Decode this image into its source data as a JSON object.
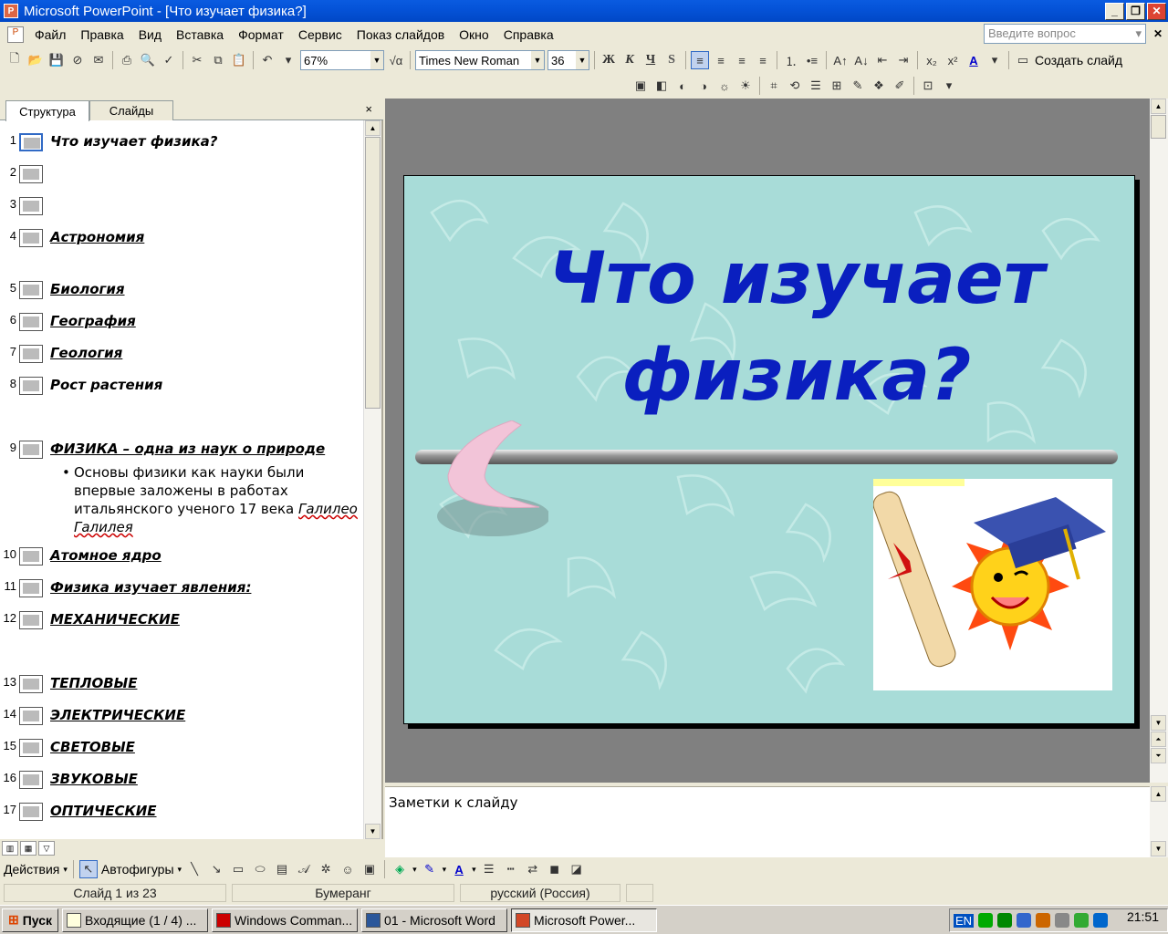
{
  "window": {
    "title": "Microsoft PowerPoint - [Что изучает физика?]",
    "minimize": "_",
    "restore": "❐",
    "close": "✕"
  },
  "menu": {
    "items": [
      "Файл",
      "Правка",
      "Вид",
      "Вставка",
      "Формат",
      "Сервис",
      "Показ слайдов",
      "Окно",
      "Справка"
    ],
    "ask_placeholder": "Введите вопрос"
  },
  "toolbar": {
    "zoom": "67%",
    "font_name": "Times New Roman",
    "font_size": "36",
    "bold": "Ж",
    "italic": "К",
    "underline": "Ч",
    "shadow": "S",
    "new_slide": "Создать слайд"
  },
  "left_pane": {
    "tab_outline": "Структура",
    "tab_slides": "Слайды",
    "close": "×",
    "slides": [
      {
        "num": "1",
        "title": "Что изучает физика?",
        "underline": false,
        "current": true
      },
      {
        "num": "2",
        "title": "",
        "underline": false
      },
      {
        "num": "3",
        "title": "",
        "underline": false
      },
      {
        "num": "4",
        "title": "Астрономия",
        "underline": true
      },
      {
        "num": "5",
        "title": "Биология",
        "underline": true
      },
      {
        "num": "6",
        "title": "География",
        "underline": true
      },
      {
        "num": "7",
        "title": "Геология",
        "underline": true
      },
      {
        "num": "8",
        "title": "Рост растения",
        "underline": false
      },
      {
        "num": "9",
        "title": "ФИЗИКА – одна из наук о природе",
        "underline": true
      },
      {
        "num": "10",
        "title": "Атомное ядро",
        "underline": true
      },
      {
        "num": "11",
        "title": "Физика изучает явления:",
        "underline": true
      },
      {
        "num": "12",
        "title": "МЕХАНИЧЕСКИЕ",
        "underline": true
      },
      {
        "num": "13",
        "title": "ТЕПЛОВЫЕ",
        "underline": true
      },
      {
        "num": "14",
        "title": "ЭЛЕКТРИЧЕСКИЕ",
        "underline": true
      },
      {
        "num": "15",
        "title": "СВЕТОВЫЕ",
        "underline": true
      },
      {
        "num": "16",
        "title": "ЗВУКОВЫЕ",
        "underline": true
      },
      {
        "num": "17",
        "title": "ОПТИЧЕСКИЕ",
        "underline": true
      }
    ],
    "slide9_bullet": {
      "text": "Основы физики как науки были впервые заложены в работах итальянского ученого 17 века",
      "name": "Галилео Галилея"
    }
  },
  "slide": {
    "title_line1": "Что изучает",
    "title_line2": "физика?",
    "title_color": "#0a1fbf",
    "background_color": "#a8dcd8"
  },
  "notes": {
    "label": "Заметки к слайду"
  },
  "drawing_toolbar": {
    "actions": "Действия",
    "autoshapes": "Автофигуры"
  },
  "status": {
    "slide_of": "Слайд 1 из 23",
    "design": "Бумеранг",
    "language": "русский (Россия)"
  },
  "taskbar": {
    "start": "Пуск",
    "tasks": [
      {
        "label": "Входящие (1 / 4) ...",
        "active": false
      },
      {
        "label": "Windows Comman...",
        "active": false
      },
      {
        "label": "01 - Microsoft Word",
        "active": false
      },
      {
        "label": "Microsoft Power...",
        "active": true
      }
    ],
    "lang": "EN",
    "clock": "21:51"
  }
}
